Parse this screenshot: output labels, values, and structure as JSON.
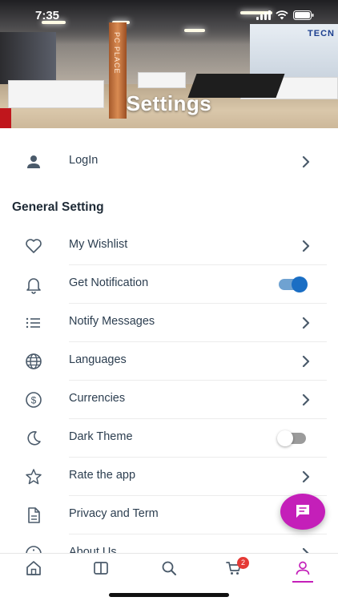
{
  "status_bar": {
    "time": "7:35"
  },
  "header": {
    "title": "Settings",
    "pillar_text": "PC PLACE",
    "brand_text": "TECN"
  },
  "login_row": {
    "label": "LogIn",
    "icon": "person-icon"
  },
  "general": {
    "title": "General Setting",
    "items": [
      {
        "label": "My Wishlist",
        "icon": "heart-icon",
        "control": "chevron"
      },
      {
        "label": "Get Notification",
        "icon": "bell-icon",
        "control": "toggle",
        "toggle_on": true
      },
      {
        "label": "Notify Messages",
        "icon": "list-icon",
        "control": "chevron"
      },
      {
        "label": "Languages",
        "icon": "globe-icon",
        "control": "chevron"
      },
      {
        "label": "Currencies",
        "icon": "dollar-icon",
        "control": "chevron"
      },
      {
        "label": "Dark Theme",
        "icon": "moon-icon",
        "control": "toggle",
        "toggle_on": false
      },
      {
        "label": "Rate the app",
        "icon": "star-icon",
        "control": "chevron"
      },
      {
        "label": "Privacy and Term",
        "icon": "document-icon",
        "control": "chevron"
      },
      {
        "label": "About Us",
        "icon": "info-icon",
        "control": "chevron"
      }
    ]
  },
  "tabbar": {
    "tabs": [
      {
        "name": "home",
        "icon": "home-icon"
      },
      {
        "name": "categories",
        "icon": "book-icon"
      },
      {
        "name": "search",
        "icon": "search-icon"
      },
      {
        "name": "cart",
        "icon": "cart-icon",
        "badge": "2"
      },
      {
        "name": "account",
        "icon": "person-icon",
        "active": true
      }
    ]
  },
  "colors": {
    "accent": "#c41fb9",
    "text": "#2c3e50",
    "icon": "#4a5a6a",
    "toggle_on": "#1a6ec4",
    "badge": "#e53935"
  }
}
